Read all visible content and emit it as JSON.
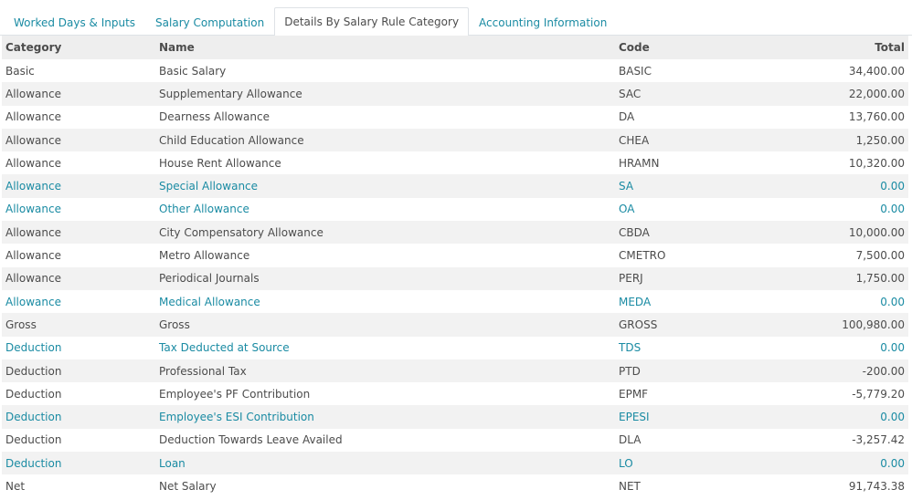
{
  "tabs": [
    {
      "label": "Worked Days & Inputs",
      "active": false
    },
    {
      "label": "Salary Computation",
      "active": false
    },
    {
      "label": "Details By Salary Rule Category",
      "active": true
    },
    {
      "label": "Accounting Information",
      "active": false
    }
  ],
  "columns": {
    "category": "Category",
    "name": "Name",
    "code": "Code",
    "total": "Total"
  },
  "rows": [
    {
      "category": "Basic",
      "name": "Basic Salary",
      "code": "BASIC",
      "total": "34,400.00",
      "zero": false
    },
    {
      "category": "Allowance",
      "name": "Supplementary Allowance",
      "code": "SAC",
      "total": "22,000.00",
      "zero": false
    },
    {
      "category": "Allowance",
      "name": "Dearness Allowance",
      "code": "DA",
      "total": "13,760.00",
      "zero": false
    },
    {
      "category": "Allowance",
      "name": "Child Education Allowance",
      "code": "CHEA",
      "total": "1,250.00",
      "zero": false
    },
    {
      "category": "Allowance",
      "name": "House Rent Allowance",
      "code": "HRAMN",
      "total": "10,320.00",
      "zero": false
    },
    {
      "category": "Allowance",
      "name": "Special Allowance",
      "code": "SA",
      "total": "0.00",
      "zero": true
    },
    {
      "category": "Allowance",
      "name": "Other Allowance",
      "code": "OA",
      "total": "0.00",
      "zero": true
    },
    {
      "category": "Allowance",
      "name": "City Compensatory Allowance",
      "code": "CBDA",
      "total": "10,000.00",
      "zero": false
    },
    {
      "category": "Allowance",
      "name": "Metro Allowance",
      "code": "CMETRO",
      "total": "7,500.00",
      "zero": false
    },
    {
      "category": "Allowance",
      "name": "Periodical Journals",
      "code": "PERJ",
      "total": "1,750.00",
      "zero": false
    },
    {
      "category": "Allowance",
      "name": "Medical Allowance",
      "code": "MEDA",
      "total": "0.00",
      "zero": true
    },
    {
      "category": "Gross",
      "name": "Gross",
      "code": "GROSS",
      "total": "100,980.00",
      "zero": false
    },
    {
      "category": "Deduction",
      "name": "Tax Deducted at Source",
      "code": "TDS",
      "total": "0.00",
      "zero": true
    },
    {
      "category": "Deduction",
      "name": "Professional Tax",
      "code": "PTD",
      "total": "-200.00",
      "zero": false
    },
    {
      "category": "Deduction",
      "name": "Employee's PF Contribution",
      "code": "EPMF",
      "total": "-5,779.20",
      "zero": false
    },
    {
      "category": "Deduction",
      "name": "Employee's ESI Contribution",
      "code": "EPESI",
      "total": "0.00",
      "zero": true
    },
    {
      "category": "Deduction",
      "name": "Deduction Towards Leave Availed",
      "code": "DLA",
      "total": "-3,257.42",
      "zero": false
    },
    {
      "category": "Deduction",
      "name": "Loan",
      "code": "LO",
      "total": "0.00",
      "zero": true
    },
    {
      "category": "Net",
      "name": "Net Salary",
      "code": "NET",
      "total": "91,743.38",
      "zero": false
    }
  ],
  "colors": {
    "link": "#1a8ba3",
    "text": "#4c4c4c",
    "header_bg": "#eeeeee",
    "stripe_bg": "#f2f2f2"
  }
}
